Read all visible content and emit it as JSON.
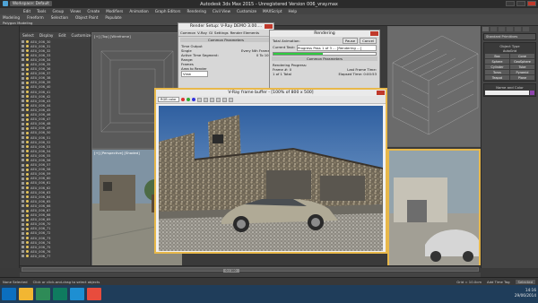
{
  "app": {
    "title": "Autodesk 3ds Max  2015  -  Unregistered Version   006_vray.max",
    "workspace": "Workspace: Default"
  },
  "menu": [
    "Edit",
    "Tools",
    "Group",
    "Views",
    "Create",
    "Modifiers",
    "Animation",
    "Graph Editors",
    "Rendering",
    "Civil View",
    "Customize",
    "MAXScript",
    "Help"
  ],
  "ribbon": {
    "tabs": [
      "Modeling",
      "Freeform",
      "Selection",
      "Object Paint",
      "Populate"
    ],
    "active": "Polygon Modeling"
  },
  "explorer": {
    "header": [
      "Select",
      "Display",
      "Edit",
      "Customize"
    ],
    "rows": [
      "AEU_006_30",
      "AEU_006_31",
      "AEU_006_32",
      "AEU_006_33",
      "AEU_006_34",
      "AEU_006_35",
      "AEU_006_36",
      "AEU_006_37",
      "AEU_006_38",
      "AEU_006_39",
      "AEU_006_40",
      "AEU_006_41",
      "AEU_006_42",
      "AEU_006_43",
      "AEU_006_44",
      "AEU_006_45",
      "AEU_006_46",
      "AEU_006_47",
      "AEU_006_48",
      "AEU_006_49",
      "AEU_006_50",
      "AEU_006_51",
      "AEU_006_52",
      "AEU_006_53",
      "AEU_006_54",
      "AEU_006_55",
      "AEU_006_56",
      "AEU_006_57",
      "AEU_006_58",
      "AEU_006_59",
      "AEU_006_60",
      "AEU_006_61",
      "AEU_006_62",
      "AEU_006_63",
      "AEU_006_64",
      "AEU_006_65",
      "AEU_006_66",
      "AEU_006_67",
      "AEU_006_68",
      "AEU_006_69",
      "AEU_006_70",
      "AEU_006_71",
      "AEU_006_72",
      "AEU_006_73",
      "AEU_006_74",
      "AEU_006_75",
      "AEU_006_76",
      "AEU_006_77"
    ]
  },
  "viewports": {
    "top_left": "[+] [Top] [Wireframe]",
    "bottom_left": "[+] [Perspective] [Shaded]",
    "top_right": "",
    "bottom_right": ""
  },
  "render_setup": {
    "title": "Render Setup: V-Ray DEMO 3.00....",
    "tabs": [
      "Common",
      "V-Ray",
      "GI",
      "Settings",
      "Render Elements"
    ],
    "section": "Common Parameters",
    "time_output": "Time Output",
    "single": "Single",
    "every_nth": "Every Nth Frame:",
    "active_segment": "Active Time Segment:",
    "active_range": "0 To 100",
    "range": "Range:",
    "frames": "Frames",
    "area_to_render": "Area to Render",
    "view": "View"
  },
  "rendering": {
    "title": "Rendering",
    "total_animation": "Total Animation:",
    "pause": "Pause",
    "cancel": "Cancel",
    "current_task": "Current Task:",
    "task_text": "Progress Pass 1 of 3 ... [Rendering ...]",
    "progress": 0.48,
    "common_params": "Common Parameters",
    "rendering_progress": "Rendering Progress:",
    "frame_num": "Frame #:",
    "frame_val": "0",
    "pass": "1 of 1",
    "total": "Total",
    "last_frame_time": "Last Frame Time:",
    "elapsed_time": "Elapsed Time:",
    "elapsed_val": "0:00:53"
  },
  "framebuffer": {
    "title": "V-Ray frame buffer - [100% of 800 x 500]",
    "channel": "RGB color"
  },
  "command_panel": {
    "dropdown": "Standard Primitives",
    "object_type": "Object Type",
    "autogrid": "AutoGrid",
    "buttons": [
      "Box",
      "Cone",
      "Sphere",
      "GeoSphere",
      "Cylinder",
      "Tube",
      "Torus",
      "Pyramid",
      "Teapot",
      "Plane"
    ],
    "name_and_color": "Name and Color"
  },
  "timeline": {
    "frame": "0 / 100"
  },
  "status": {
    "selected": "None Selected",
    "hint": "Click or click-and-drag to select objects",
    "grid": "Grid = 10.0cm",
    "addkey": "Add Time Tag",
    "selected_mode": "Selected"
  },
  "taskbar": {
    "time": "14:16",
    "date": "29/06/2014",
    "colors": [
      "#0b6fbf",
      "#f2b632",
      "#2e8b57",
      "#0f7b5f",
      "#1e8fd2",
      "#e84c3d"
    ]
  }
}
